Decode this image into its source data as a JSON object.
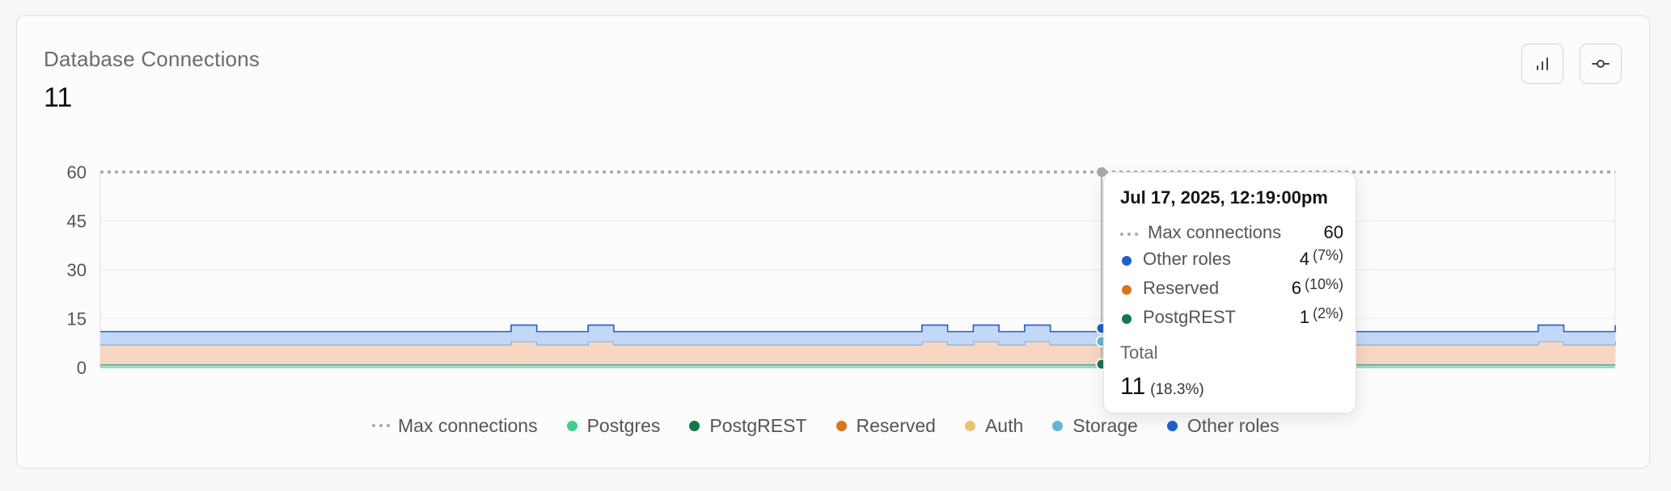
{
  "header": {
    "title": "Database Connections",
    "value": "11"
  },
  "controls": [
    {
      "name": "bar-chart-toggle",
      "icon": "bar-chart-icon"
    },
    {
      "name": "line-chart-toggle",
      "icon": "line-point-icon"
    }
  ],
  "colors": {
    "max": "#a8a8a8",
    "postgres": "#3ecf8e",
    "postgrest": "#0f7a4c",
    "reserved": "#d97514",
    "auth": "#e9c46a",
    "storage": "#5fb8dc",
    "other": "#1a5fd6"
  },
  "chart_data": {
    "type": "area",
    "x_count": 60,
    "hover_index": 39,
    "ylim": [
      0,
      60
    ],
    "yticks": [
      "60",
      "45",
      "30",
      "15",
      "0"
    ],
    "ytick_values": [
      60,
      45,
      30,
      15,
      0
    ],
    "grid": true,
    "legend_position": "bottom",
    "max_line": {
      "name": "Max connections",
      "value": 60
    },
    "series": [
      {
        "name": "Postgres",
        "key": "postgres",
        "values": [
          0,
          0,
          0,
          0,
          0,
          0,
          0,
          0,
          0,
          0,
          0,
          0,
          0,
          0,
          0,
          0,
          0,
          0,
          0,
          0,
          0,
          0,
          0,
          0,
          0,
          0,
          0,
          0,
          0,
          0,
          0,
          0,
          0,
          0,
          0,
          0,
          0,
          0,
          0,
          0,
          0,
          0,
          0,
          0,
          0,
          0,
          0,
          0,
          0,
          0,
          0,
          0,
          0,
          0,
          0,
          0,
          0,
          0,
          0,
          0
        ]
      },
      {
        "name": "PostgREST",
        "key": "postgrest",
        "values": [
          1,
          1,
          1,
          1,
          1,
          1,
          1,
          1,
          1,
          1,
          1,
          1,
          1,
          1,
          1,
          1,
          1,
          1,
          1,
          1,
          1,
          1,
          1,
          1,
          1,
          1,
          1,
          1,
          1,
          1,
          1,
          1,
          1,
          1,
          1,
          1,
          1,
          1,
          1,
          1,
          1,
          1,
          1,
          1,
          1,
          1,
          1,
          1,
          1,
          1,
          1,
          1,
          1,
          1,
          1,
          1,
          1,
          1,
          1,
          1
        ]
      },
      {
        "name": "Reserved",
        "key": "reserved",
        "values": [
          6,
          6,
          6,
          6,
          6,
          6,
          6,
          6,
          6,
          6,
          6,
          6,
          6,
          6,
          6,
          6,
          7,
          6,
          6,
          7,
          6,
          6,
          6,
          6,
          6,
          6,
          6,
          6,
          6,
          6,
          6,
          6,
          7,
          6,
          7,
          6,
          7,
          6,
          6,
          7,
          6,
          6,
          6,
          6,
          6,
          6,
          6,
          6,
          6,
          6,
          6,
          6,
          6,
          6,
          6,
          6,
          7,
          6,
          6,
          7
        ]
      },
      {
        "name": "Auth",
        "key": "auth",
        "values": [
          0,
          0,
          0,
          0,
          0,
          0,
          0,
          0,
          0,
          0,
          0,
          0,
          0,
          0,
          0,
          0,
          0,
          0,
          0,
          0,
          0,
          0,
          0,
          0,
          0,
          0,
          0,
          0,
          0,
          0,
          0,
          0,
          0,
          0,
          0,
          0,
          0,
          0,
          0,
          0,
          0,
          0,
          0,
          0,
          0,
          0,
          0,
          0,
          0,
          0,
          0,
          0,
          0,
          0,
          0,
          0,
          0,
          0,
          0,
          0
        ]
      },
      {
        "name": "Storage",
        "key": "storage",
        "values": [
          0,
          0,
          0,
          0,
          0,
          0,
          0,
          0,
          0,
          0,
          0,
          0,
          0,
          0,
          0,
          0,
          0,
          0,
          0,
          0,
          0,
          0,
          0,
          0,
          0,
          0,
          0,
          0,
          0,
          0,
          0,
          0,
          0,
          0,
          0,
          0,
          0,
          0,
          0,
          0,
          0,
          0,
          0,
          0,
          0,
          0,
          0,
          0,
          0,
          0,
          0,
          0,
          0,
          0,
          0,
          0,
          0,
          0,
          0,
          0
        ]
      },
      {
        "name": "Other roles",
        "key": "other",
        "values": [
          4,
          4,
          4,
          4,
          4,
          4,
          4,
          4,
          4,
          4,
          4,
          4,
          4,
          4,
          4,
          4,
          5,
          4,
          4,
          5,
          4,
          4,
          4,
          4,
          4,
          4,
          4,
          4,
          4,
          4,
          4,
          4,
          5,
          4,
          5,
          4,
          5,
          4,
          4,
          4,
          4,
          4,
          4,
          4,
          4,
          4,
          4,
          4,
          4,
          4,
          4,
          4,
          4,
          4,
          4,
          4,
          5,
          4,
          4,
          5
        ]
      }
    ]
  },
  "tooltip": {
    "date": "Jul 17, 2025, 12:19:00pm",
    "rows": [
      {
        "key": "max",
        "label": "Max connections",
        "value": "60",
        "pct": ""
      },
      {
        "key": "other",
        "label": "Other roles",
        "value": "4",
        "pct": "(7%)"
      },
      {
        "key": "reserved",
        "label": "Reserved",
        "value": "6",
        "pct": "(10%)"
      },
      {
        "key": "postgrest",
        "label": "PostgREST",
        "value": "1",
        "pct": "(2%)"
      }
    ],
    "total_label": "Total",
    "total_value": "11",
    "total_pct": "(18.3%)"
  },
  "legend": [
    {
      "key": "max",
      "label": "Max connections"
    },
    {
      "key": "postgres",
      "label": "Postgres"
    },
    {
      "key": "postgrest",
      "label": "PostgREST"
    },
    {
      "key": "reserved",
      "label": "Reserved"
    },
    {
      "key": "auth",
      "label": "Auth"
    },
    {
      "key": "storage",
      "label": "Storage"
    },
    {
      "key": "other",
      "label": "Other roles"
    }
  ]
}
